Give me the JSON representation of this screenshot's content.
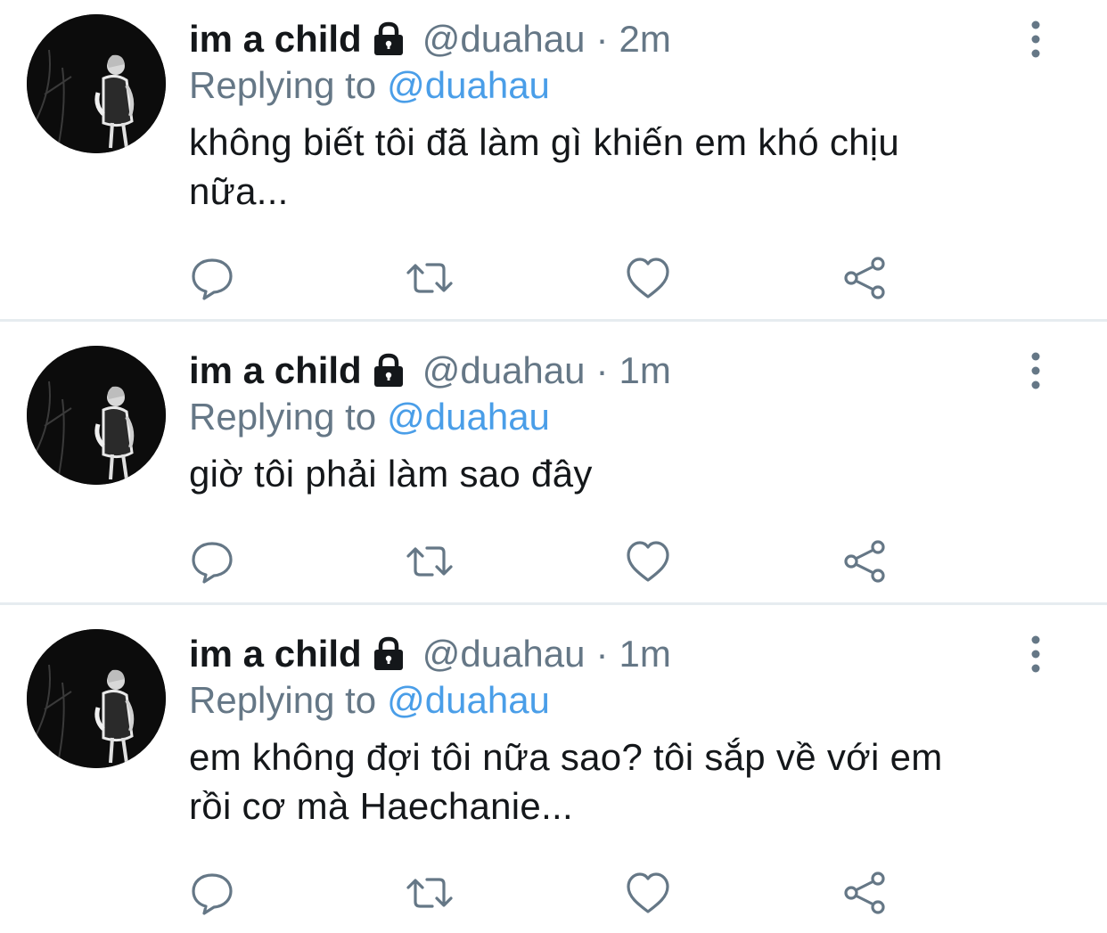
{
  "colors": {
    "text": "#14171a",
    "secondary": "#657786",
    "link": "#4a9ee8",
    "divider": "#e6ecf0",
    "icon": "#657786"
  },
  "icons": {
    "reply": "speech-bubble-icon",
    "retweet": "retweet-icon",
    "like": "heart-icon",
    "share": "share-icon",
    "more": "vertical-dots-icon",
    "protected": "lock-icon"
  },
  "tweets": [
    {
      "name": "im a child",
      "handle": "@duahau",
      "separator": "·",
      "time": "2m",
      "replying_label": "Replying to",
      "replying_handle": "@duahau",
      "text_lines": [
        "không biết tôi đã làm gì khiến em khó chịu",
        "nữa..."
      ]
    },
    {
      "name": "im a child",
      "handle": "@duahau",
      "separator": "·",
      "time": "1m",
      "replying_label": "Replying to",
      "replying_handle": "@duahau",
      "text_lines": [
        "giờ tôi phải làm sao đây"
      ]
    },
    {
      "name": "im a child",
      "handle": "@duahau",
      "separator": "·",
      "time": "1m",
      "replying_label": "Replying to",
      "replying_handle": "@duahau",
      "text_lines": [
        "em không đợi tôi nữa sao? tôi sắp về với em",
        "rồi cơ mà Haechanie..."
      ]
    }
  ]
}
